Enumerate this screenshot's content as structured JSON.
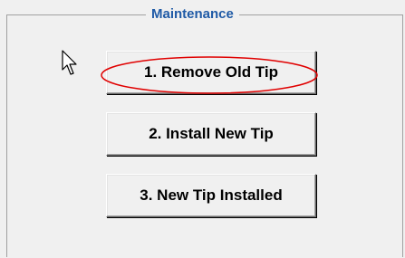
{
  "groupbox": {
    "title": "Maintenance"
  },
  "buttons": [
    {
      "label": "1. Remove Old Tip"
    },
    {
      "label": "2. Install New Tip"
    },
    {
      "label": "3. New Tip Installed"
    }
  ],
  "highlight": {
    "color": "#e00000",
    "target": "1. Remove Old Tip"
  },
  "cursor": {
    "icon": "arrow-pointer-icon"
  }
}
